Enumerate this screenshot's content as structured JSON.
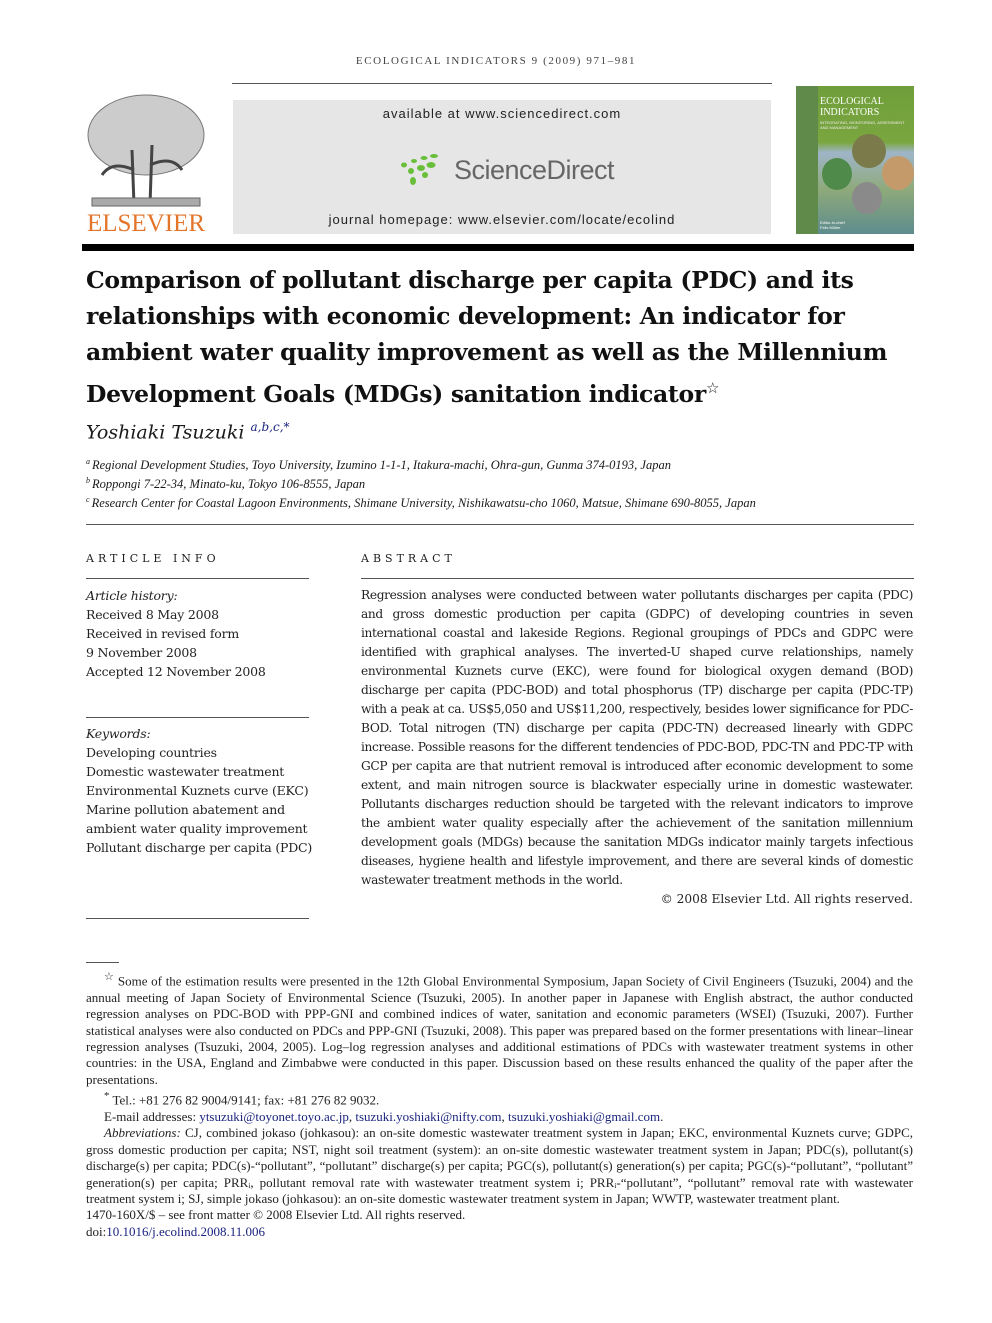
{
  "running_head": "ECOLOGICAL INDICATORS 9 (2009) 971–981",
  "publisher": {
    "logo_icon": "elsevier-tree-icon",
    "name": "ELSEVIER",
    "brand_color": "#e3752b"
  },
  "sciencedirect": {
    "available": "available at www.sciencedirect.com",
    "logo_text": "ScienceDirect",
    "logo_color": "#6abf3a",
    "homepage": "journal homepage: www.elsevier.com/locate/ecolind"
  },
  "cover": {
    "title_line1": "ECOLOGICAL",
    "title_line2": "INDICATORS",
    "subtitle": "INTEGRATING, MONITORING, ASSESSMENT AND MANAGEMENT",
    "editor_label": "Editor-in-chief",
    "editor": "Felix Müller"
  },
  "article": {
    "title": "Comparison of pollutant discharge per capita (PDC) and its relationships with economic development: An indicator for ambient water quality improvement as well as the Millennium Development Goals (MDGs) sanitation indicator",
    "title_mark": "☆",
    "author": "Yoshiaki Tsuzuki",
    "author_marks": "a,b,c,*",
    "affiliations": [
      {
        "mark": "a",
        "text": "Regional Development Studies, Toyo University, Izumino 1-1-1, Itakura-machi, Ohra-gun, Gunma 374-0193, Japan"
      },
      {
        "mark": "b",
        "text": "Roppongi 7-22-34, Minato-ku, Tokyo 106-8555, Japan"
      },
      {
        "mark": "c",
        "text": "Research Center for Coastal Lagoon Environments, Shimane University, Nishikawatsu-cho 1060, Matsue, Shimane 690-8055, Japan"
      }
    ]
  },
  "article_info": {
    "heading": "ARTICLE INFO",
    "history_label": "Article history:",
    "history": [
      "Received 8 May 2008",
      "Received in revised form",
      "9 November 2008",
      "Accepted 12 November 2008"
    ],
    "keywords_label": "Keywords:",
    "keywords": [
      "Developing countries",
      "Domestic wastewater treatment",
      "Environmental Kuznets curve (EKC)",
      "Marine pollution abatement and",
      "ambient water quality improvement",
      "Pollutant discharge per capita (PDC)"
    ]
  },
  "abstract": {
    "heading": "ABSTRACT",
    "text": "Regression analyses were conducted between water pollutants discharges per capita (PDC) and gross domestic production per capita (GDPC) of developing countries in seven international coastal and lakeside Regions. Regional groupings of PDCs and GDPC were identified with graphical analyses. The inverted-U shaped curve relationships, namely environmental Kuznets curve (EKC), were found for biological oxygen demand (BOD) discharge per capita (PDC-BOD) and total phosphorus (TP) discharge per capita (PDC-TP) with a peak at ca. US$5,050 and US$11,200, respectively, besides lower significance for PDC-BOD. Total nitrogen (TN) discharge per capita (PDC-TN) decreased linearly with GDPC increase. Possible reasons for the different tendencies of PDC-BOD, PDC-TN and PDC-TP with GCP per capita are that nutrient removal is introduced after economic development to some extent, and main nitrogen source is blackwater especially urine in domestic wastewater. Pollutants discharges reduction should be targeted with the relevant indicators to improve the ambient water quality especially after the achievement of the sanitation millennium development goals (MDGs) because the sanitation MDGs indicator mainly targets infectious diseases, hygiene health and lifestyle improvement, and there are several kinds of domestic wastewater treatment methods in the world.",
    "copyright": "© 2008 Elsevier Ltd. All rights reserved."
  },
  "footnotes": {
    "star_mark": "☆",
    "star_text": "Some of the estimation results were presented in the 12th Global Environmental Symposium, Japan Society of Civil Engineers (Tsuzuki, 2004) and the annual meeting of Japan Society of Environmental Science (Tsuzuki, 2005). In another paper in Japanese with English abstract, the author conducted regression analyses on PDC-BOD with PPP-GNI and combined indices of water, sanitation and economic parameters (WSEI) (Tsuzuki, 2007). Further statistical analyses were also conducted on PDCs and PPP-GNI (Tsuzuki, 2008). This paper was prepared based on the former presentations with linear–linear regression analyses (Tsuzuki, 2004, 2005). Log–log regression analyses and additional estimations of PDCs with wastewater treatment systems in other countries: in the USA, England and Zimbabwe were conducted in this paper. Discussion based on these results enhanced the quality of the paper after the presentations.",
    "corr_mark": "*",
    "corr_text": "Tel.: +81 276 82 9004/9141; fax: +81 276 82 9032.",
    "email_label": "E-mail addresses:",
    "emails": [
      "ytsuzuki@toyonet.toyo.ac.jp",
      "tsuzuki.yoshiaki@nifty.com",
      "tsuzuki.yoshiaki@gmail.com"
    ],
    "abbrev_label": "Abbreviations:",
    "abbrev_text": "CJ, combined jokaso (johkasou): an on-site domestic wastewater treatment system in Japan; EKC, environmental Kuznets curve; GDPC, gross domestic production per capita; NST, night soil treatment (system): an on-site domestic wastewater treatment system in Japan; PDC(s), pollutant(s) discharge(s) per capita; PDC(s)-“pollutant”, “pollutant” discharge(s) per capita; PGC(s), pollutant(s) generation(s) per capita; PGC(s)-“pollutant”, “pollutant” generation(s) per capita; PRRᵢ, pollutant removal rate with wastewater treatment system i; PRRᵢ-“pollutant”, “pollutant” removal rate with wastewater treatment system i; SJ, simple jokaso (johkasou): an on-site domestic wastewater treatment system in Japan; WWTP, wastewater treatment plant.",
    "front_matter": "1470-160X/$ – see front matter © 2008 Elsevier Ltd. All rights reserved.",
    "doi_label": "doi:",
    "doi": "10.1016/j.ecolind.2008.11.006"
  }
}
